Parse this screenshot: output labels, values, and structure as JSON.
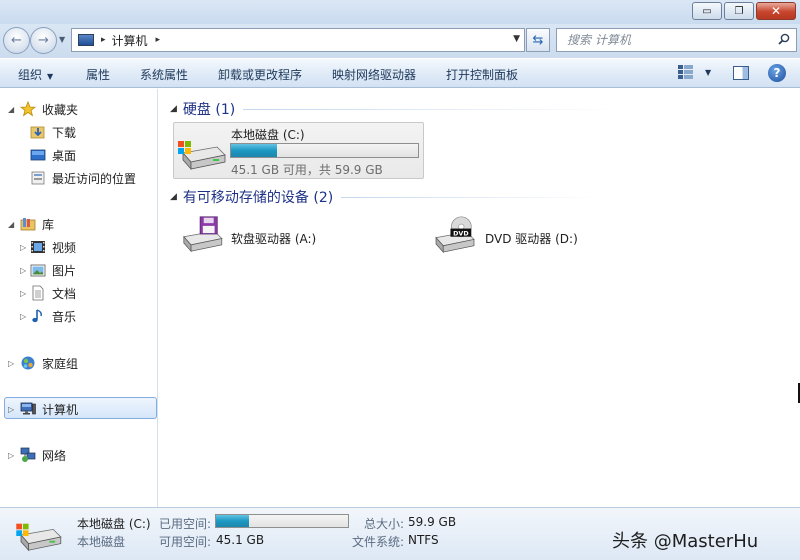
{
  "window": {
    "minimize_glyph": "▭",
    "maximize_glyph": "❐",
    "close_glyph": "✕"
  },
  "address": {
    "location": "计算机",
    "separator": "▸",
    "trailing_separator": "▸",
    "search_placeholder": "搜索 计算机"
  },
  "toolbar": {
    "organize": "组织",
    "properties": "属性",
    "system_properties": "系统属性",
    "uninstall": "卸载或更改程序",
    "map_drive": "映射网络驱动器",
    "control_panel": "打开控制面板",
    "help": "?"
  },
  "nav": {
    "favorites": "收藏夹",
    "downloads": "下载",
    "desktop": "桌面",
    "recent": "最近访问的位置",
    "libraries": "库",
    "videos": "视频",
    "pictures": "图片",
    "documents": "文档",
    "music": "音乐",
    "homegroup": "家庭组",
    "computer": "计算机",
    "network": "网络"
  },
  "groups": {
    "hard_disk": "硬盘 (1)",
    "removable": "有可移动存储的设备 (2)"
  },
  "drives": {
    "c": {
      "name": "本地磁盘 (C:)",
      "usage_text": "45.1 GB 可用，共 59.9 GB",
      "used_fraction": 0.247
    },
    "a": {
      "name": "软盘驱动器 (A:)"
    },
    "d": {
      "name": "DVD 驱动器 (D:)",
      "badge": "DVD"
    }
  },
  "details": {
    "name": "本地磁盘 (C:)",
    "type": "本地磁盘",
    "used_label": "已用空间:",
    "free_label": "可用空间:",
    "free_value": "45.1 GB",
    "total_label": "总大小:",
    "total_value": "59.9 GB",
    "fs_label": "文件系统:",
    "fs_value": "NTFS",
    "used_fraction": 0.247
  },
  "watermark": "头条 @MasterHu",
  "colors": {
    "accent_blue": "#1e3287",
    "bar_fill": "#1c98c2",
    "selection": "#d5e6fa"
  }
}
